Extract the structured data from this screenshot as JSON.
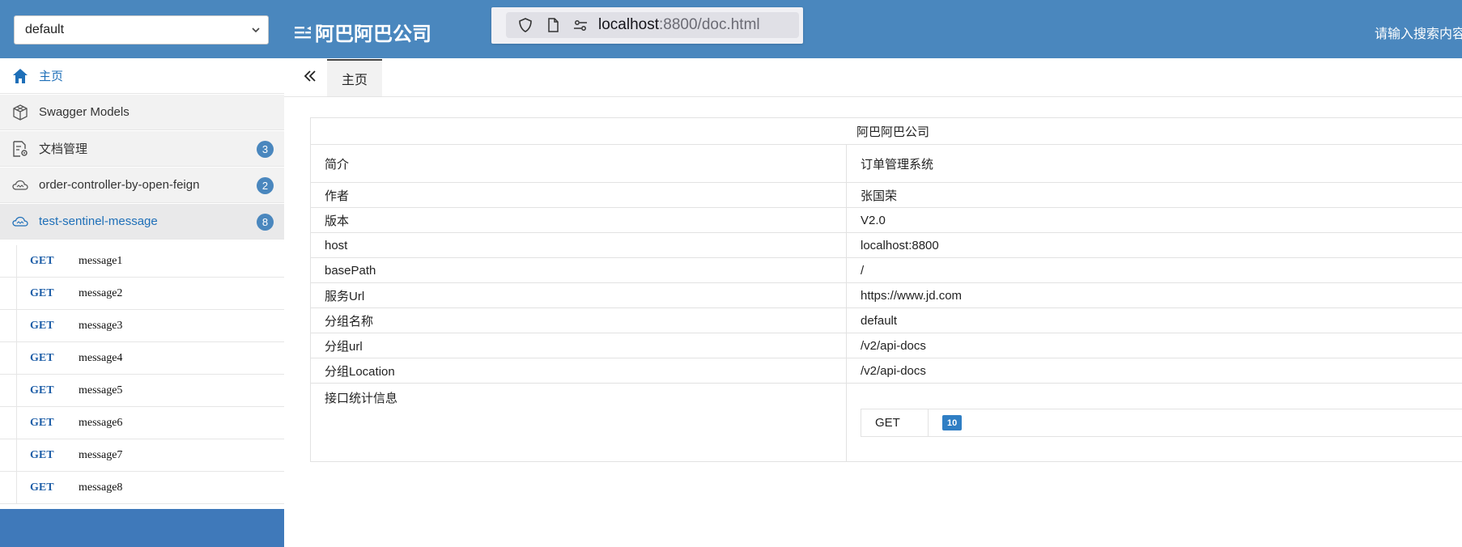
{
  "header": {
    "group_select_value": "default",
    "brand_title": "阿巴阿巴公司",
    "url_host": "localhost",
    "url_rest": ":8800/doc.html",
    "search_placeholder": "请输入搜索内容"
  },
  "sidebar": {
    "home": "主页",
    "swagger_models": "Swagger Models",
    "doc_manage": {
      "label": "文档管理",
      "badge": "3"
    },
    "order_controller": {
      "label": "order-controller-by-open-feign",
      "badge": "2"
    },
    "test_sentinel": {
      "label": "test-sentinel-message",
      "badge": "8"
    },
    "apis": [
      {
        "method": "GET",
        "path": "message1"
      },
      {
        "method": "GET",
        "path": "message2"
      },
      {
        "method": "GET",
        "path": "message3"
      },
      {
        "method": "GET",
        "path": "message4"
      },
      {
        "method": "GET",
        "path": "message5"
      },
      {
        "method": "GET",
        "path": "message6"
      },
      {
        "method": "GET",
        "path": "message7"
      },
      {
        "method": "GET",
        "path": "message8"
      }
    ]
  },
  "main": {
    "tab_home": "主页",
    "info_title": "阿巴阿巴公司",
    "rows": [
      {
        "key": "简介",
        "value": "订单管理系统"
      },
      {
        "key": "作者",
        "value": "张国荣"
      },
      {
        "key": "版本",
        "value": "V2.0"
      },
      {
        "key": "host",
        "value": "localhost:8800"
      },
      {
        "key": "basePath",
        "value": "/"
      },
      {
        "key": "服务Url",
        "value": "https://www.jd.com"
      },
      {
        "key": "分组名称",
        "value": "default"
      },
      {
        "key": "分组url",
        "value": "/v2/api-docs"
      },
      {
        "key": "分组Location",
        "value": "/v2/api-docs"
      }
    ],
    "stats": {
      "key": "接口统计信息",
      "method": "GET",
      "count": "10"
    }
  },
  "colors": {
    "header_bg": "#4a87be",
    "accent": "#1e6fb8",
    "badge": "#4a87be"
  }
}
